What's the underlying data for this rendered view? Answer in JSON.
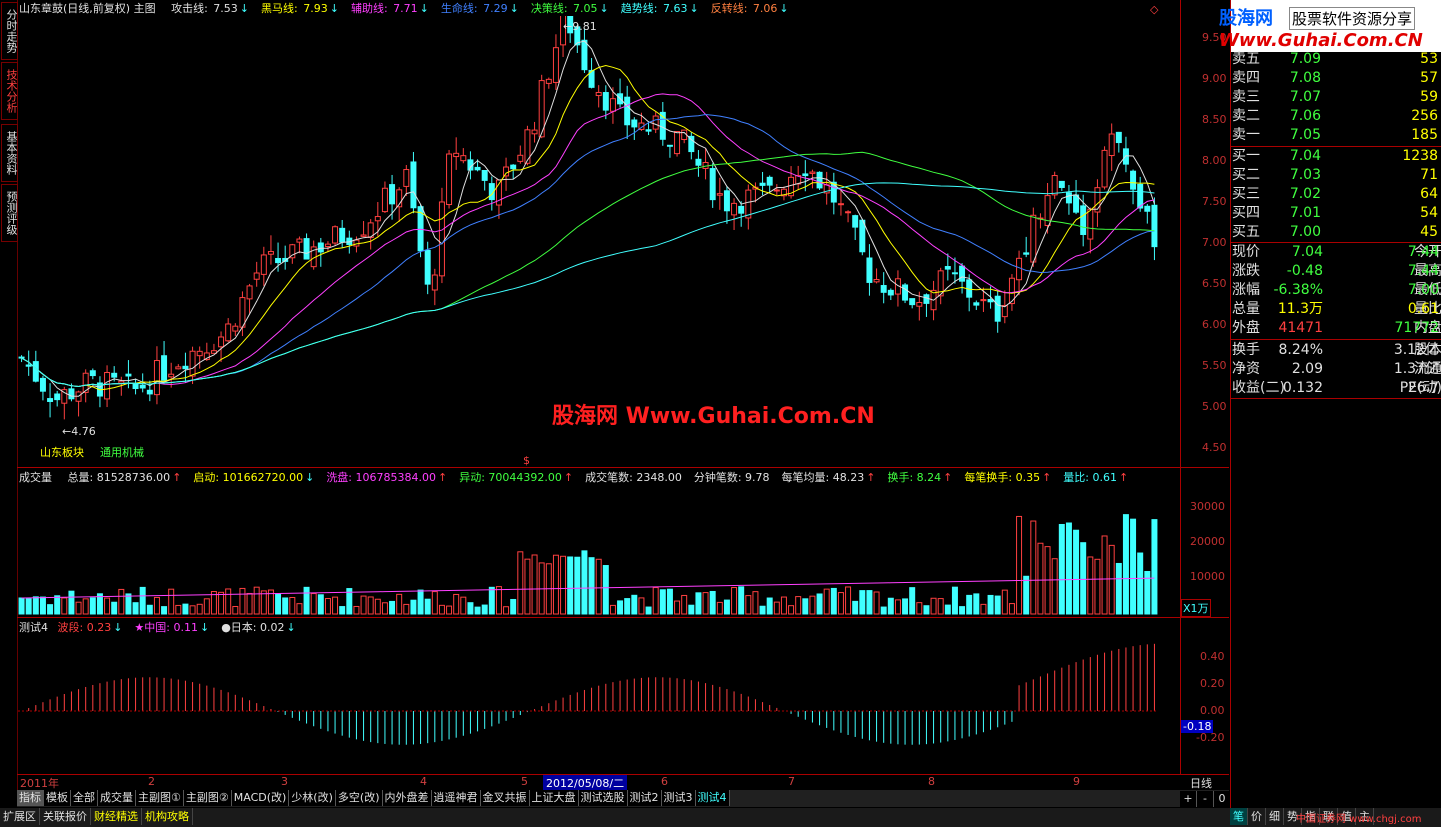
{
  "main_chart": {
    "stock_label": "山东章鼓(日线,前复权) 主图",
    "indicators": [
      {
        "name": "攻击线:",
        "value": "7.53",
        "arrow": "↓",
        "color": "#e0e0e0"
      },
      {
        "name": "黑马线:",
        "value": "7.93",
        "arrow": "↓",
        "color": "#ffff00"
      },
      {
        "name": "辅助线:",
        "value": "7.71",
        "arrow": "↓",
        "color": "#ff40ff"
      },
      {
        "name": "生命线:",
        "value": "7.29",
        "arrow": "↓",
        "color": "#4080ff"
      },
      {
        "name": "决策线:",
        "value": "7.05",
        "arrow": "↓",
        "color": "#40ff40"
      },
      {
        "name": "趋势线:",
        "value": "7.63",
        "arrow": "↓",
        "color": "#40ffff"
      },
      {
        "name": "反转线:",
        "value": "7.06",
        "arrow": "↓",
        "color": "#ff8040"
      }
    ],
    "price_axis": [
      "9.50",
      "9.00",
      "8.50",
      "8.00",
      "7.50",
      "7.00",
      "6.50",
      "6.00",
      "5.50",
      "5.00",
      "4.50"
    ],
    "high_label": "9.81",
    "low_label": "4.76",
    "sector_label": "山东板块",
    "industry_label": "通用机械",
    "watermark": "股海网 Www.Guhai.Com.CN"
  },
  "volume_panel": {
    "label": "成交量",
    "stats": [
      {
        "text": "总量: 81528736.00",
        "arrow": "↑",
        "color": "#e0e0e0"
      },
      {
        "text": "启动: 101662720.00",
        "arrow": "↓",
        "color": "#ffff00"
      },
      {
        "text": "洗盘: 106785384.00",
        "arrow": "↑",
        "color": "#ff40ff"
      },
      {
        "text": "异动: 70044392.00",
        "arrow": "↑",
        "color": "#40ff40"
      },
      {
        "text": "成交笔数: 2348.00",
        "arrow": "",
        "color": "#e0e0e0"
      },
      {
        "text": "分钟笔数: 9.78",
        "arrow": "",
        "color": "#e0e0e0"
      },
      {
        "text": "每笔均量: 48.23",
        "arrow": "↑",
        "color": "#e0e0e0"
      },
      {
        "text": "换手: 8.24",
        "arrow": "↑",
        "color": "#40ff40"
      },
      {
        "text": "每笔换手: 0.35",
        "arrow": "↑",
        "color": "#ffff00"
      },
      {
        "text": "量比: 0.61",
        "arrow": "↑",
        "color": "#40ffff"
      }
    ],
    "axis": [
      "30000",
      "20000",
      "10000"
    ],
    "unit": "X1万"
  },
  "indicator_panel": {
    "label": "测试4",
    "stats": [
      {
        "text": "波段: 0.23",
        "arrow": "↓",
        "color": "#ff4040"
      },
      {
        "text": "★中国: 0.11",
        "arrow": "↓",
        "color": "#ff40ff"
      },
      {
        "text": "●日本: 0.02",
        "arrow": "↓",
        "color": "#e0e0e0"
      }
    ],
    "axis": [
      "0.40",
      "0.20",
      "0.00",
      "-0.20"
    ],
    "current_value": "-0.18"
  },
  "x_axis": {
    "labels": [
      "2011年",
      "2",
      "3",
      "4",
      "5",
      "6",
      "7",
      "8",
      "9"
    ],
    "cursor_date": "2012/05/08/二",
    "period": "日线"
  },
  "side_tabs": [
    "分时走势",
    "技术分析",
    "基本资料",
    "预测评级"
  ],
  "bottom_tabs": [
    "指标",
    "模板",
    "全部",
    "成交量",
    "主副图①",
    "主副图②",
    "MACD(改)",
    "少林(改)",
    "多空(改)",
    "内外盘差",
    "逍遥神君",
    "金叉共振",
    "上证大盘",
    "测试选股",
    "测试2",
    "测试3",
    "测试4"
  ],
  "bottom_controls": [
    "+",
    "-",
    "0"
  ],
  "status_tabs": [
    "扩展区",
    "关联报价",
    "财经精选",
    "机构攻略"
  ],
  "right_status": [
    "笔",
    "价",
    "细",
    "势",
    "指",
    "联",
    "值",
    "主"
  ],
  "status_watermark": "中国证券网 www.chgj.com",
  "logo": {
    "site": "股海网",
    "slogan": "股票软件资源分享",
    "url": "Www.Guhai.Com.CN"
  },
  "order_book": {
    "sells": [
      {
        "label": "卖五",
        "price": "7.09",
        "vol": "53"
      },
      {
        "label": "卖四",
        "price": "7.08",
        "vol": "57"
      },
      {
        "label": "卖三",
        "price": "7.07",
        "vol": "59"
      },
      {
        "label": "卖二",
        "price": "7.06",
        "vol": "256"
      },
      {
        "label": "卖一",
        "price": "7.05",
        "vol": "185"
      }
    ],
    "buys": [
      {
        "label": "买一",
        "price": "7.04",
        "vol": "1238"
      },
      {
        "label": "买二",
        "price": "7.03",
        "vol": "71"
      },
      {
        "label": "买三",
        "price": "7.02",
        "vol": "64"
      },
      {
        "label": "买四",
        "price": "7.01",
        "vol": "54"
      },
      {
        "label": "买五",
        "price": "7.00",
        "vol": "45"
      }
    ]
  },
  "quote": [
    {
      "l1": "现价",
      "v1": "7.04",
      "c1": "#40ff40",
      "l2": "今开",
      "v2": "7.44",
      "c2": "#40ff40"
    },
    {
      "l1": "涨跌",
      "v1": "-0.48",
      "c1": "#40ff40",
      "l2": "最高",
      "v2": "7.44",
      "c2": "#40ff40"
    },
    {
      "l1": "涨幅",
      "v1": "-6.38%",
      "c1": "#40ff40",
      "l2": "最低",
      "v2": "7.00",
      "c2": "#40ff40"
    },
    {
      "l1": "总量",
      "v1": "11.3万",
      "c1": "#ffff00",
      "l2": "量比",
      "v2": "0.61",
      "c2": "#ffff00"
    },
    {
      "l1": "外盘",
      "v1": "41471",
      "c1": "#ff4040",
      "l2": "内盘",
      "v2": "71772",
      "c2": "#40ff40"
    }
  ],
  "fundamentals": [
    {
      "l1": "换手",
      "v1": "8.24%",
      "l2": "股本",
      "v2": "3.12亿"
    },
    {
      "l1": "净资",
      "v1": "2.09",
      "l2": "流通",
      "v2": "1.37亿"
    },
    {
      "l1": "收益(二)",
      "v1": "0.132",
      "l2": "PE(动)",
      "v2": "26.7"
    }
  ],
  "colors": {
    "up": "#ff4040",
    "down": "#40ffff",
    "grid": "#aa0000"
  }
}
